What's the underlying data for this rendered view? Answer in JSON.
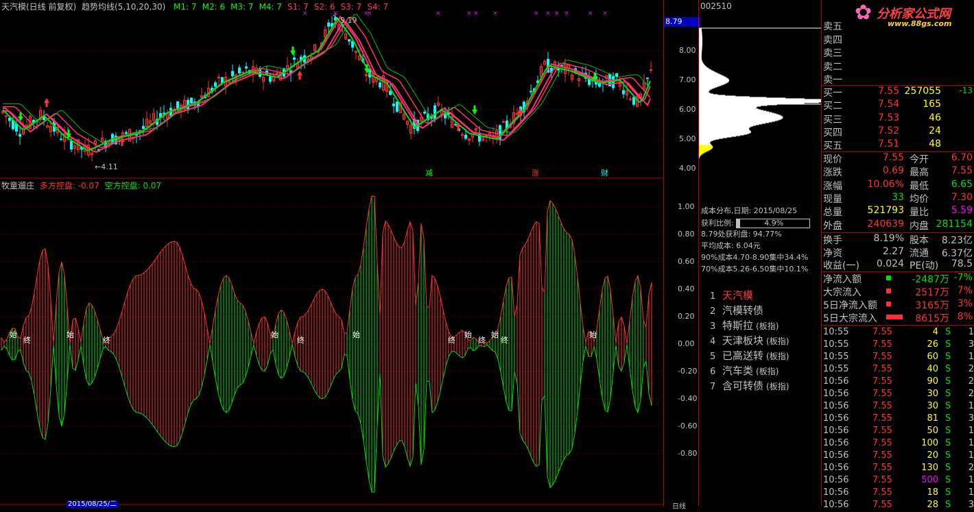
{
  "main_chart": {
    "title": "天汽模(日线 前复权)",
    "indicator_name": "趋势均线(5,10,20,30)",
    "params": [
      {
        "label": "M1: 7",
        "color": "#00ff00"
      },
      {
        "label": "M2: 6",
        "color": "#00ff00"
      },
      {
        "label": "M3: 7",
        "color": "#00ff00"
      },
      {
        "label": "M4: 7",
        "color": "#00ff00"
      },
      {
        "label": "S1: 7",
        "color": "#ff3070"
      },
      {
        "label": "S2: 6",
        "color": "#ff3070"
      },
      {
        "label": "S3: 7",
        "color": "#ff3070"
      },
      {
        "label": "S4: 7",
        "color": "#ff3070"
      }
    ],
    "price_labels": [
      "8.00",
      "7.00",
      "6.00",
      "5.00",
      "4.00"
    ],
    "current_price_tag": "8.79",
    "high_mark": "9.19",
    "low_mark": "4.11",
    "event_labels": [
      "减",
      "涨",
      "财"
    ]
  },
  "sub_chart": {
    "title": "牧童遛庄",
    "long_label": "多方控盘: -0.07",
    "short_label": "空方控盘: 0.07",
    "axis_labels": [
      "1.00",
      "0.80",
      "0.60",
      "0.40",
      "0.20",
      "0.00",
      "-0.20",
      "-0.40",
      "-0.60",
      "-0.80"
    ],
    "marks": [
      "始",
      "终",
      "始",
      "终",
      "始",
      "终",
      "始",
      "终",
      "始",
      "终",
      "始",
      "终",
      "始"
    ]
  },
  "bottom_axis": {
    "date_label": "2015/08/25/二",
    "period": "日线"
  },
  "cost": {
    "code": "002510",
    "title": "成本分布,日期: 2015/08/25",
    "profit_ratio_label": "获利比例:",
    "profit_ratio": "4.9%",
    "profit_line": "8.79处获利盘: 94.77%",
    "avg_cost": "平均成本: 6.04元",
    "c90": "90%成本4.70-8.90集中34.4%",
    "c70": "70%成本5.26-6.50集中10.1%"
  },
  "related": [
    {
      "num": "1",
      "name": "天汽模",
      "tag": "",
      "color": "#ff3232"
    },
    {
      "num": "2",
      "name": "汽模转债",
      "tag": "",
      "color": "#c0c0c0"
    },
    {
      "num": "3",
      "name": "特斯拉",
      "tag": "(板指)",
      "color": "#c0c0c0"
    },
    {
      "num": "4",
      "name": "天津板块",
      "tag": "(板指)",
      "color": "#c0c0c0"
    },
    {
      "num": "5",
      "name": "已高送转",
      "tag": "(板指)",
      "color": "#c0c0c0"
    },
    {
      "num": "6",
      "name": "汽车类",
      "tag": "(板指)",
      "color": "#c0c0c0"
    },
    {
      "num": "7",
      "name": "含可转债",
      "tag": "(板指)",
      "color": "#c0c0c0"
    }
  ],
  "logo": {
    "text": "分析家公式网",
    "url": "www.88gs.com"
  },
  "orderbook": {
    "sells": [
      "卖五",
      "卖四",
      "卖三",
      "卖二",
      "卖一"
    ],
    "buys": [
      {
        "label": "买一",
        "price": "7.55",
        "vol": "257055",
        "chg": "-13"
      },
      {
        "label": "买二",
        "price": "7.54",
        "vol": "165",
        "chg": ""
      },
      {
        "label": "买三",
        "price": "7.53",
        "vol": "46",
        "chg": ""
      },
      {
        "label": "买四",
        "price": "7.52",
        "vol": "24",
        "chg": ""
      },
      {
        "label": "买五",
        "price": "7.51",
        "vol": "48",
        "chg": ""
      }
    ]
  },
  "quote": {
    "now_l": "现价",
    "now_v": "7.55",
    "open_l": "今开",
    "open_v": "6.70",
    "chg_l": "涨跌",
    "chg_v": "0.69",
    "high_l": "最高",
    "high_v": "7.55",
    "pct_l": "涨幅",
    "pct_v": "10.06%",
    "low_l": "最低",
    "low_v": "6.65",
    "vol_l": "现量",
    "vol_v": "33",
    "avg_l": "均价",
    "avg_v": "7.30",
    "tot_l": "总量",
    "tot_v": "521793",
    "ratio_l": "量比",
    "ratio_v": "5.59",
    "out_l": "外盘",
    "out_v": "240639",
    "in_l": "内盘",
    "in_v": "281154",
    "turn_l": "换手",
    "turn_v": "8.19%",
    "cap_l": "股本",
    "cap_v": "8.23亿",
    "nav_l": "净资",
    "nav_v": "2.27",
    "float_l": "流通",
    "float_v": "6.37亿",
    "eps_l": "收益(一)",
    "eps_v": "0.024",
    "pe_l": "PE(动)",
    "pe_v": "78.5"
  },
  "flows": [
    {
      "label": "净流入额",
      "value": "-2487万",
      "pct": "-7%",
      "color": "#00e000"
    },
    {
      "label": "大宗流入",
      "value": "2517万",
      "pct": "7%",
      "color": "#ff3232"
    },
    {
      "label": "5日净流入额",
      "value": "3165万",
      "pct": "3%",
      "color": "#ff3232"
    },
    {
      "label": "5日大宗流入",
      "value": "8615万",
      "pct": "8%",
      "color": "#ff3232"
    }
  ],
  "trades": [
    {
      "time": "10:55",
      "price": "7.55",
      "vol": "4",
      "side": "S",
      "n": "1"
    },
    {
      "time": "10:55",
      "price": "7.55",
      "vol": "26",
      "side": "S",
      "n": "3"
    },
    {
      "time": "10:55",
      "price": "7.55",
      "vol": "60",
      "side": "S",
      "n": "1"
    },
    {
      "time": "10:55",
      "price": "7.55",
      "vol": "40",
      "side": "S",
      "n": "2"
    },
    {
      "time": "10:56",
      "price": "7.55",
      "vol": "90",
      "side": "S",
      "n": "2"
    },
    {
      "time": "10:56",
      "price": "7.55",
      "vol": "30",
      "side": "S",
      "n": "2"
    },
    {
      "time": "10:56",
      "price": "7.55",
      "vol": "30",
      "side": "S",
      "n": "1"
    },
    {
      "time": "10:56",
      "price": "7.55",
      "vol": "81",
      "side": "S",
      "n": "3"
    },
    {
      "time": "10:56",
      "price": "7.55",
      "vol": "50",
      "side": "S",
      "n": "1"
    },
    {
      "time": "10:56",
      "price": "7.55",
      "vol": "100",
      "side": "S",
      "n": "1"
    },
    {
      "time": "10:56",
      "price": "7.55",
      "vol": "20",
      "side": "S",
      "n": "1"
    },
    {
      "time": "10:56",
      "price": "7.55",
      "vol": "130",
      "side": "S",
      "n": "2"
    },
    {
      "time": "10:56",
      "price": "7.55",
      "vol": "500",
      "side": "S",
      "n": "1"
    },
    {
      "time": "10:56",
      "price": "7.55",
      "vol": "18",
      "side": "S",
      "n": "1"
    },
    {
      "time": "10:56",
      "price": "7.55",
      "vol": "28",
      "side": "S",
      "n": "3"
    }
  ]
}
